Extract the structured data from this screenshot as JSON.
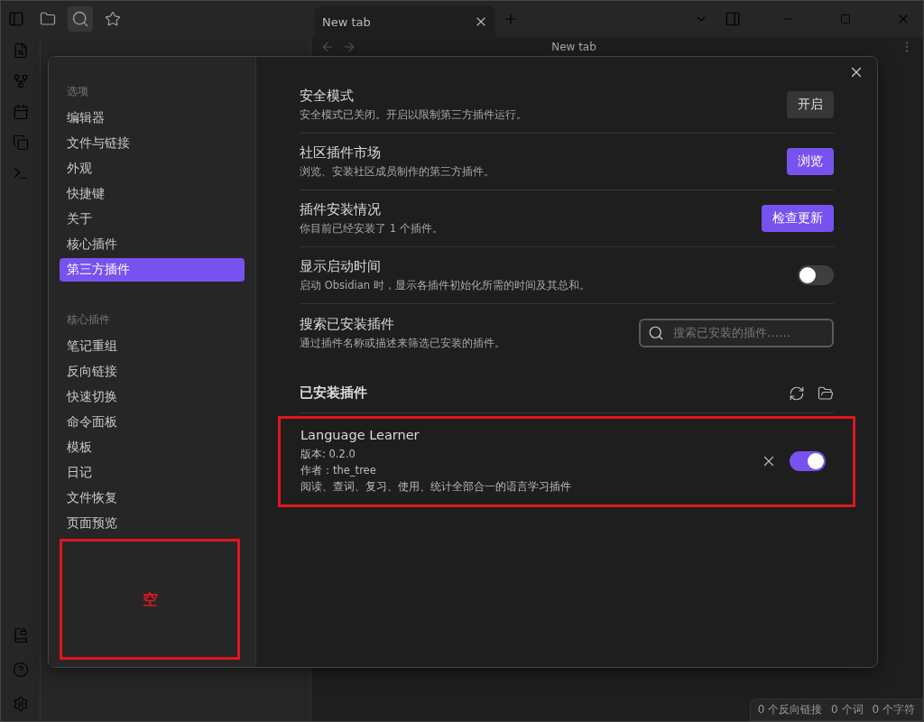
{
  "tabs": [
    {
      "label": "New tab",
      "selected": true
    }
  ],
  "view_header": {
    "title": "New tab"
  },
  "settings": {
    "nav": [
      {
        "heading": "选项",
        "items": [
          {
            "label": "编辑器",
            "selected": false
          },
          {
            "label": "文件与链接",
            "selected": false
          },
          {
            "label": "外观",
            "selected": false
          },
          {
            "label": "快捷键",
            "selected": false
          },
          {
            "label": "关于",
            "selected": false
          },
          {
            "label": "核心插件",
            "selected": false
          },
          {
            "label": "第三方插件",
            "selected": true
          }
        ]
      },
      {
        "heading": "核心插件",
        "items": [
          {
            "label": "笔记重组",
            "selected": false
          },
          {
            "label": "反向链接",
            "selected": false
          },
          {
            "label": "快速切换",
            "selected": false
          },
          {
            "label": "命令面板",
            "selected": false
          },
          {
            "label": "模板",
            "selected": false
          },
          {
            "label": "日记",
            "selected": false
          },
          {
            "label": "文件恢复",
            "selected": false
          },
          {
            "label": "页面预览",
            "selected": false
          }
        ]
      }
    ],
    "nav_annotation": {
      "label": "空"
    },
    "rows": [
      {
        "kind": "button",
        "title": "安全模式",
        "description": "安全模式已关闭。开启以限制第三方插件运行。",
        "button": "开启",
        "primary": false
      },
      {
        "kind": "button",
        "title": "社区插件市场",
        "description": "浏览、安装社区成员制作的第三方插件。",
        "button": "浏览",
        "primary": true
      },
      {
        "kind": "button",
        "title": "插件安装情况",
        "description": "你目前已经安装了 1 个插件。",
        "button": "检查更新",
        "primary": true
      },
      {
        "kind": "toggle",
        "title": "显示启动时间",
        "description": "启动 Obsidian 时，显示各插件初始化所需的时间及其总和。",
        "on": false
      },
      {
        "kind": "search",
        "title": "搜索已安装插件",
        "description": "通过插件名称或描述来筛选已安装的插件。",
        "placeholder": "搜索已安装的插件……"
      }
    ],
    "installed_heading": "已安装插件",
    "plugins": [
      {
        "name": "Language Learner",
        "version": "版本: 0.2.0",
        "author": "作者：the_tree",
        "description": "阅读、查词、复习、使用、统计全部合一的语言学习插件",
        "enabled": true,
        "highlighted": true
      }
    ]
  },
  "status_bar": [
    "0 个反向链接",
    "0 个词",
    "0 个字符"
  ]
}
